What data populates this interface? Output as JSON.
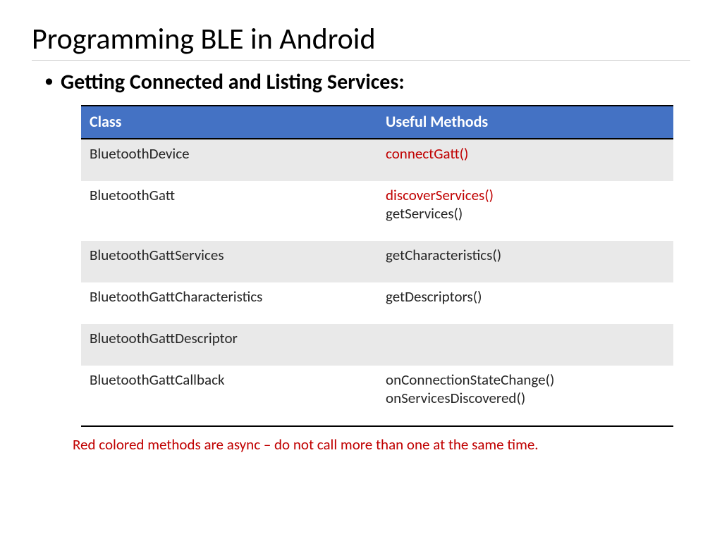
{
  "title": "Programming BLE in Android",
  "subtitle": "Getting Connected and Listing Services:",
  "table": {
    "headers": {
      "class": "Class",
      "methods": "Useful Methods"
    },
    "rows": [
      {
        "class": "BluetoothDevice",
        "methods": [
          {
            "text": "connectGatt()",
            "async": true
          }
        ]
      },
      {
        "class": "BluetoothGatt",
        "methods": [
          {
            "text": "discoverServices()",
            "async": true
          },
          {
            "text": "getServices()",
            "async": false
          }
        ]
      },
      {
        "class": "BluetoothGattServices",
        "methods": [
          {
            "text": "getCharacteristics()",
            "async": false
          }
        ]
      },
      {
        "class": "BluetoothGattCharacteristics",
        "methods": [
          {
            "text": "getDescriptors()",
            "async": false
          }
        ]
      },
      {
        "class": "BluetoothGattDescriptor",
        "methods": []
      },
      {
        "class": "BluetoothGattCallback",
        "methods": [
          {
            "text": "onConnectionStateChange()",
            "async": false
          },
          {
            "text": "onServicesDiscovered()",
            "async": false
          }
        ]
      }
    ]
  },
  "footnote": "Red colored methods are async – do not call more than one at the same time."
}
